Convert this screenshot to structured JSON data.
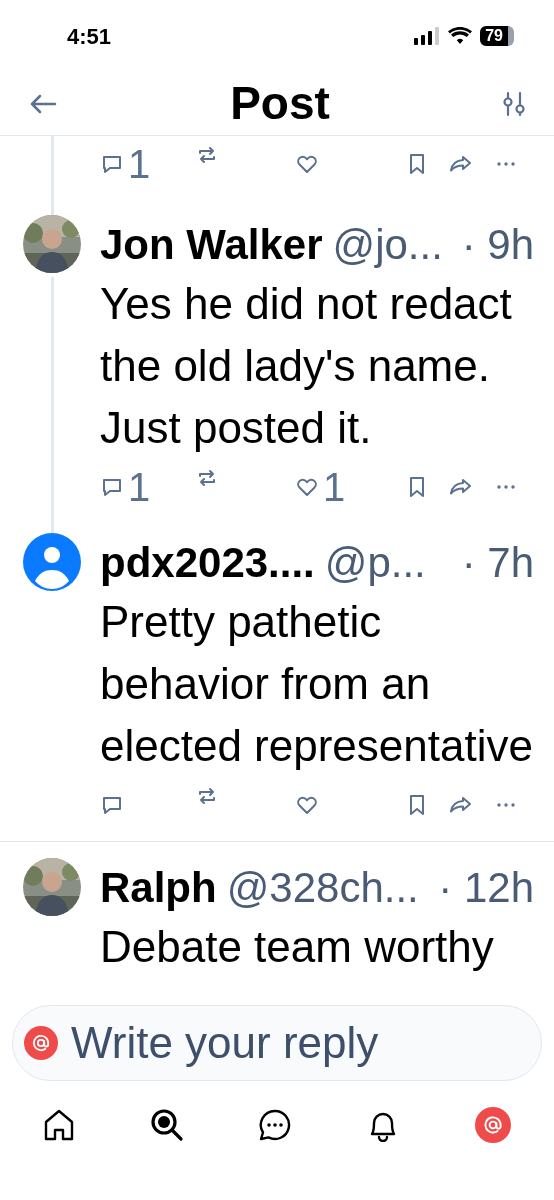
{
  "status_bar": {
    "time": "4:51",
    "battery": "79"
  },
  "header": {
    "title": "Post"
  },
  "posts": [
    {
      "kind": "partial",
      "thread_below": true,
      "actions": {
        "replies": "1"
      }
    },
    {
      "kind": "full",
      "name": "Jon Walker",
      "handle": "@jo...",
      "time": "· 9h",
      "text": "Yes he did not redact the old lady's name. Just posted it.",
      "thread_below": true,
      "actions": {
        "replies": "1",
        "likes": "1"
      }
    },
    {
      "kind": "full",
      "avatar": {
        "kind": "default"
      },
      "name": "pdx2023....",
      "handle": "@p...",
      "time": "· 7h",
      "text": "Pretty pathetic behavior from an elected representative",
      "thread_below": false
    },
    {
      "kind": "cut",
      "name": "Ralph",
      "handle": "@328ch...",
      "time": "· 12h",
      "text": "Debate team worthy",
      "thread_below": false
    }
  ],
  "reply_field": {
    "placeholder": "Write your reply"
  },
  "nav": [
    {
      "kind": "home",
      "selected": false
    },
    {
      "kind": "search",
      "selected": true
    },
    {
      "kind": "chat",
      "selected": false
    },
    {
      "kind": "bell",
      "selected": false
    },
    {
      "kind": "profile",
      "selected": false
    }
  ]
}
